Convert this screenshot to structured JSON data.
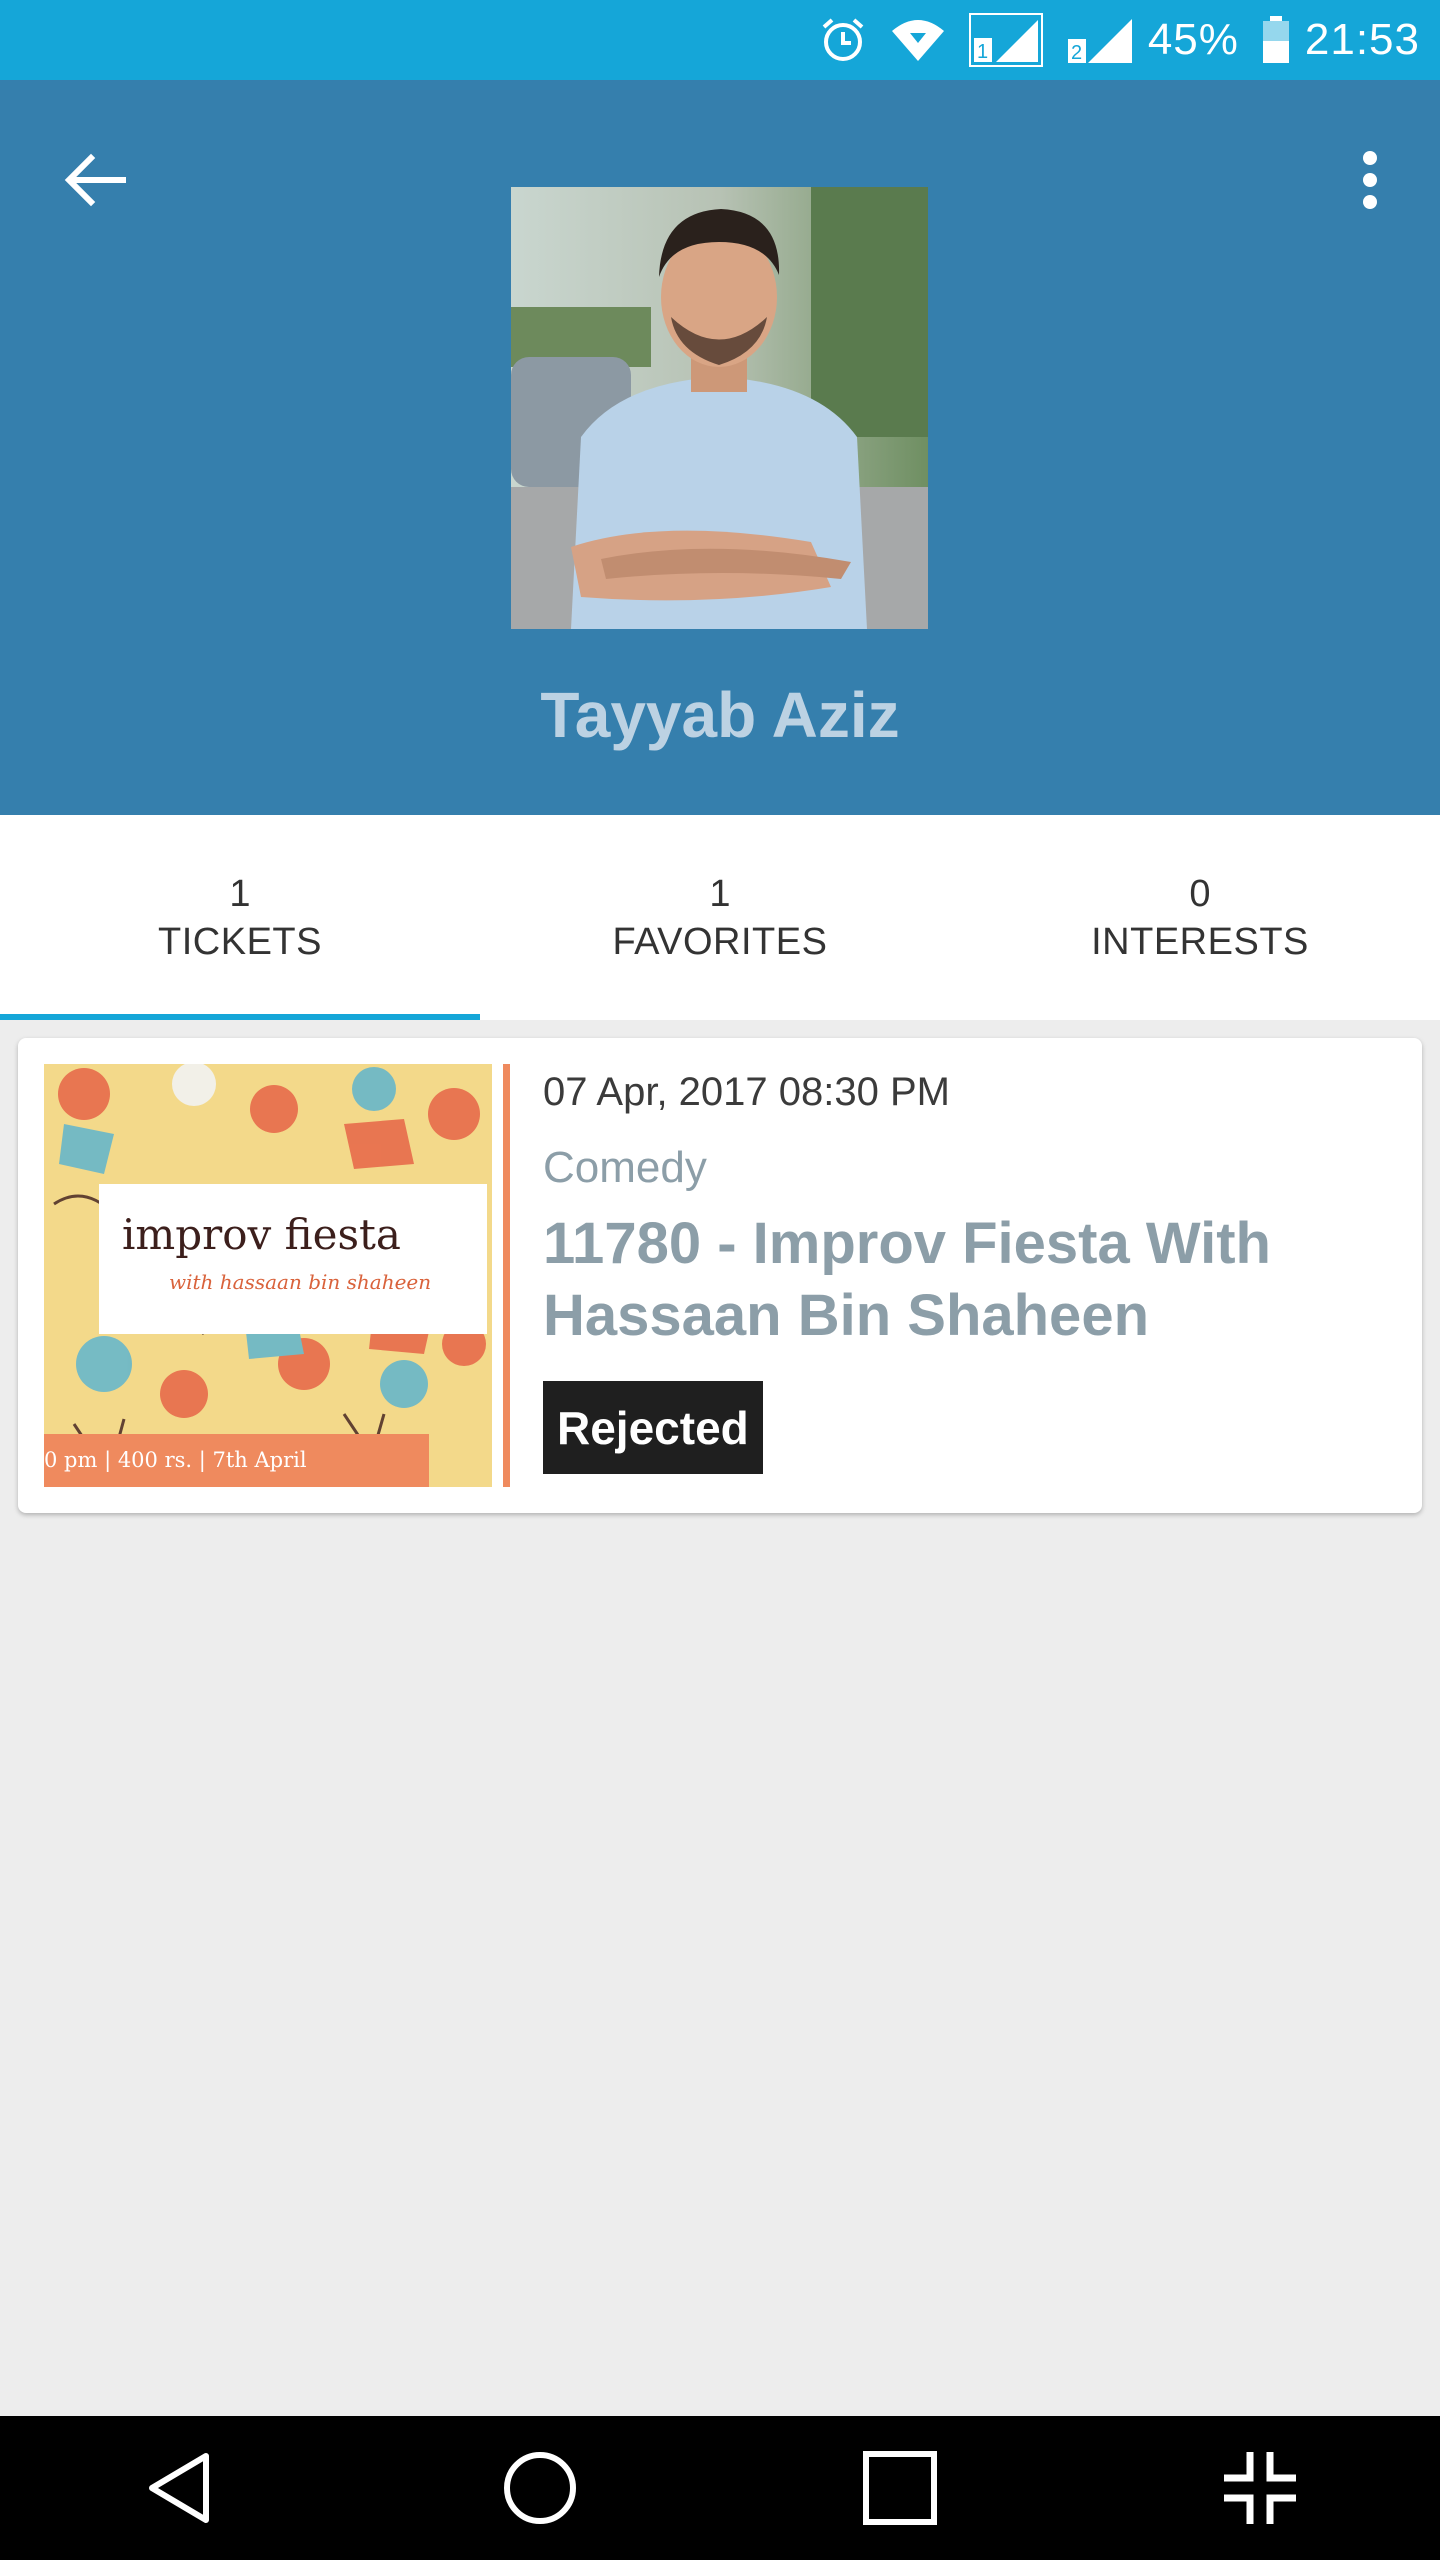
{
  "status_bar": {
    "battery": "45%",
    "time": "21:53",
    "icons": [
      "alarm-icon",
      "wifi-icon",
      "signal-sim1-icon",
      "signal-sim2-icon",
      "battery-icon"
    ]
  },
  "header": {
    "profile_name": "Tayyab Aziz",
    "background_color": "#357fad"
  },
  "tabs": [
    {
      "count": "1",
      "label": "TICKETS",
      "active": true
    },
    {
      "count": "1",
      "label": "FAVORITES",
      "active": false
    },
    {
      "count": "0",
      "label": "INTERESTS",
      "active": false
    }
  ],
  "tickets": [
    {
      "datetime": "07 Apr, 2017 08:30 PM",
      "category": "Comedy",
      "title": "11780 - Improv Fiesta With Hassaan Bin Shaheen",
      "status": "Rejected",
      "poster": {
        "headline": "improv fiesta",
        "subline": "with hassaan bin shaheen",
        "footer": "0 pm | 400 rs. | 7th April"
      }
    }
  ],
  "colors": {
    "status_bar": "#15a6d8",
    "accent": "#15a6d8",
    "muted_text": "#8c9ea8",
    "badge": "#1f1f1f"
  }
}
